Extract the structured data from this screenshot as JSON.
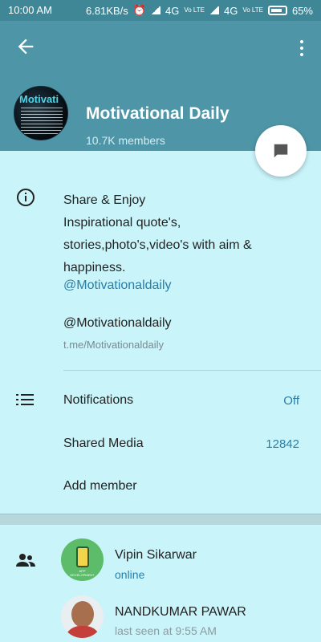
{
  "status_bar": {
    "time": "10:00 AM",
    "speed": "6.81KB/s",
    "network1": "4G",
    "network2": "4G",
    "lte1": "Vo LTE",
    "lte2": "Vo LTE",
    "battery": "65%"
  },
  "header": {
    "channel_name": "Motivational Daily",
    "members": "10.7K members",
    "avatar_text": "Motivati",
    "colors": {
      "header_bg": "#4e96a7",
      "status_bg": "#3f8797",
      "page_bg": "#c9f4fa",
      "accent": "#2b7ea6"
    }
  },
  "description": {
    "line1": "Share & Enjoy",
    "line2": "Inspirational quote's,",
    "line3": "stories,photo's,video's with aim &",
    "line4": "happiness.",
    "link": "@Motivationaldaily"
  },
  "username": {
    "handle": "@Motivationaldaily",
    "url": "t.me/Motivationaldaily"
  },
  "settings": {
    "notifications_label": "Notifications",
    "notifications_value": "Off",
    "shared_media_label": "Shared Media",
    "shared_media_value": "12842",
    "add_member_label": "Add member"
  },
  "members_list": [
    {
      "name": "Vipin Sikarwar",
      "status": "online",
      "status_color": "#2b7ea6",
      "avatar_caption": "APP DEVELOPMENT"
    },
    {
      "name": "NANDKUMAR PAWAR",
      "status": "last seen at 9:55 AM",
      "status_color": "#8a9ba0"
    }
  ],
  "icons": {
    "back": "back-arrow-icon",
    "more": "more-vertical-icon",
    "message": "message-icon",
    "info": "info-icon",
    "list": "list-icon",
    "members": "people-icon"
  }
}
